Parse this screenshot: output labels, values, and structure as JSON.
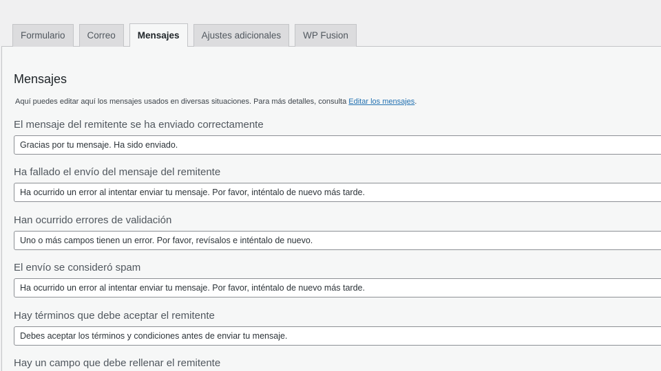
{
  "tabs": [
    {
      "label": "Formulario",
      "active": false
    },
    {
      "label": "Correo",
      "active": false
    },
    {
      "label": "Mensajes",
      "active": true
    },
    {
      "label": "Ajustes adicionales",
      "active": false
    },
    {
      "label": "WP Fusion",
      "active": false
    }
  ],
  "section": {
    "title": "Mensajes",
    "description_prefix": "Aquí puedes editar aquí los mensajes usados en diversas situaciones. Para más detalles, consulta ",
    "description_link": "Editar los mensajes",
    "description_suffix": "."
  },
  "fields": [
    {
      "label": "El mensaje del remitente se ha enviado correctamente",
      "value": "Gracias por tu mensaje. Ha sido enviado."
    },
    {
      "label": "Ha fallado el envío del mensaje del remitente",
      "value": "Ha ocurrido un error al intentar enviar tu mensaje. Por favor, inténtalo de nuevo más tarde."
    },
    {
      "label": "Han ocurrido errores de validación",
      "value": "Uno o más campos tienen un error. Por favor, revísalos e inténtalo de nuevo."
    },
    {
      "label": "El envío se consideró spam",
      "value": "Ha ocurrido un error al intentar enviar tu mensaje. Por favor, inténtalo de nuevo más tarde."
    },
    {
      "label": "Hay términos que debe aceptar el remitente",
      "value": "Debes aceptar los términos y condiciones antes de enviar tu mensaje."
    },
    {
      "label": "Hay un campo que debe rellenar el remitente",
      "value": ""
    }
  ]
}
